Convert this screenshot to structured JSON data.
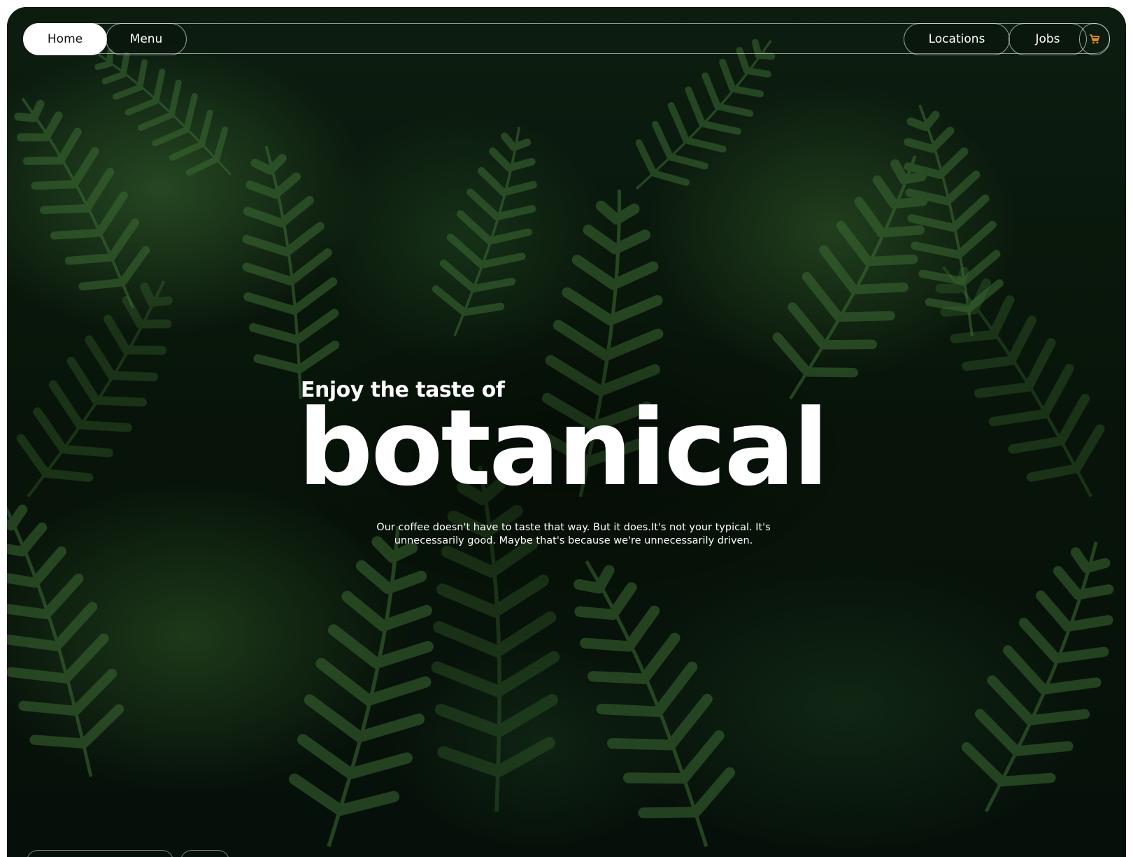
{
  "nav": {
    "left": [
      {
        "label": "Home",
        "active": true
      },
      {
        "label": "Menu",
        "active": false
      }
    ],
    "right": [
      {
        "label": "Locations"
      },
      {
        "label": "Jobs"
      }
    ],
    "cart_icon": "shopping-cart-icon",
    "cart_color": "#e98a1d"
  },
  "hero": {
    "kicker": "Enjoy the taste of",
    "title": "botanical",
    "description": "Our coffee doesn't have to taste that way. But it does.It's not your typical. It's unnecessarily good. Maybe that's because we're unnecessarily driven."
  },
  "background": {
    "image": "fern-leaves-photo",
    "colors": {
      "dark": "#06100a",
      "leaf": "#2f5a2a"
    }
  }
}
